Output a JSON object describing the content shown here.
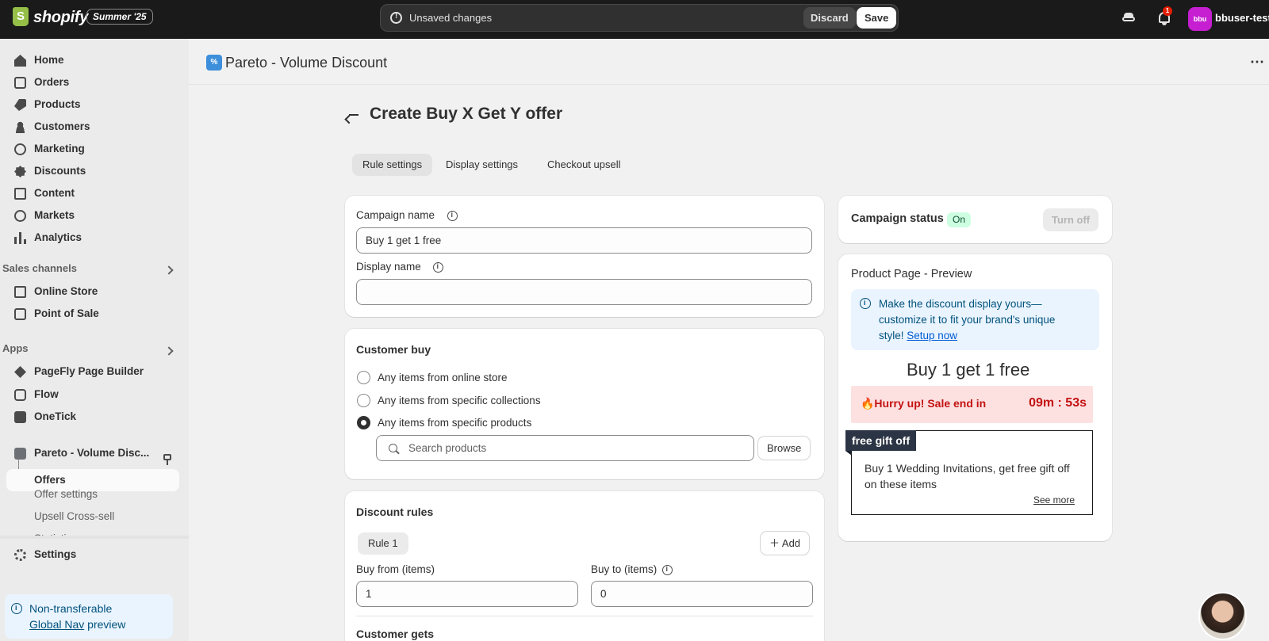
{
  "topbar": {
    "brand": "shopify",
    "edition_badge": "Summer '25",
    "unsaved_text": "Unsaved changes",
    "discard_label": "Discard",
    "save_label": "Save",
    "notification_count": "1",
    "avatar_initials": "bbu",
    "username": "bbuser-test"
  },
  "sidebar": {
    "main_items": [
      {
        "label": "Home",
        "icon": "home-icon"
      },
      {
        "label": "Orders",
        "icon": "orders-icon"
      },
      {
        "label": "Products",
        "icon": "products-icon"
      },
      {
        "label": "Customers",
        "icon": "customers-icon"
      },
      {
        "label": "Marketing",
        "icon": "marketing-icon"
      },
      {
        "label": "Discounts",
        "icon": "discounts-icon"
      },
      {
        "label": "Content",
        "icon": "content-icon"
      },
      {
        "label": "Markets",
        "icon": "markets-icon"
      },
      {
        "label": "Analytics",
        "icon": "analytics-icon"
      }
    ],
    "sales_channels_heading": "Sales channels",
    "sales_channels": [
      {
        "label": "Online Store",
        "icon": "online-store-icon"
      },
      {
        "label": "Point of Sale",
        "icon": "point-of-sale-icon"
      }
    ],
    "apps_heading": "Apps",
    "apps": [
      {
        "label": "PageFly Page Builder",
        "icon": "pagefly-icon"
      },
      {
        "label": "Flow",
        "icon": "flow-icon"
      },
      {
        "label": "OneTick",
        "icon": "onetick-icon"
      },
      {
        "label": "Pareto - Volume Disc...",
        "icon": "pareto-icon"
      }
    ],
    "pareto_subitems": [
      {
        "label": "Offers",
        "active": true
      },
      {
        "label": "Offer settings"
      },
      {
        "label": "Upsell Cross-sell"
      },
      {
        "label": "Statistics"
      }
    ],
    "settings_label": "Settings",
    "notice_line1": "Non-transferable",
    "notice_link": "Global Nav",
    "notice_suffix": " preview"
  },
  "app_header": {
    "logo_text": "%",
    "title": "Pareto - Volume Discount",
    "more_icon": "⋯"
  },
  "page": {
    "title": "Create Buy X Get Y offer",
    "tabs": [
      {
        "label": "Rule settings",
        "active": true
      },
      {
        "label": "Display settings"
      },
      {
        "label": "Checkout upsell"
      }
    ]
  },
  "campaign": {
    "name_label": "Campaign name",
    "name_value": "Buy 1 get 1 free",
    "display_label": "Display name",
    "display_value": ""
  },
  "customer_buy": {
    "title": "Customer buy",
    "options": [
      {
        "label": "Any items from online store",
        "checked": false
      },
      {
        "label": "Any items from specific collections",
        "checked": false
      },
      {
        "label": "Any items from specific products",
        "checked": true
      }
    ],
    "search_placeholder": "Search products",
    "browse_label": "Browse"
  },
  "discount_rules": {
    "title": "Discount rules",
    "rule_label": "Rule 1",
    "add_label": "Add",
    "buy_from_label": "Buy from (items)",
    "buy_from_value": "1",
    "buy_to_label": "Buy to (items)",
    "buy_to_value": "0",
    "customer_gets_title": "Customer gets"
  },
  "status": {
    "label": "Campaign status",
    "badge": "On",
    "turn_off_label": "Turn off"
  },
  "preview": {
    "title": "Product Page - Preview",
    "banner_text": "Make the discount display yours—customize it to fit your brand's unique style! ",
    "banner_link": "Setup now",
    "offer_title": "Buy 1 get 1 free",
    "hurry_text": "🔥Hurry up! Sale end in",
    "timer": "09m : 53s",
    "gift_tag": "free gift off",
    "gift_text": "Buy 1 Wedding Invitations, get free gift off on these items",
    "see_more": "See more"
  },
  "colors": {
    "topbar_bg": "#1a1a1a",
    "status_on_bg": "#cdfee1",
    "hurry_red": "#c41212",
    "info_blue": "#00527c"
  }
}
